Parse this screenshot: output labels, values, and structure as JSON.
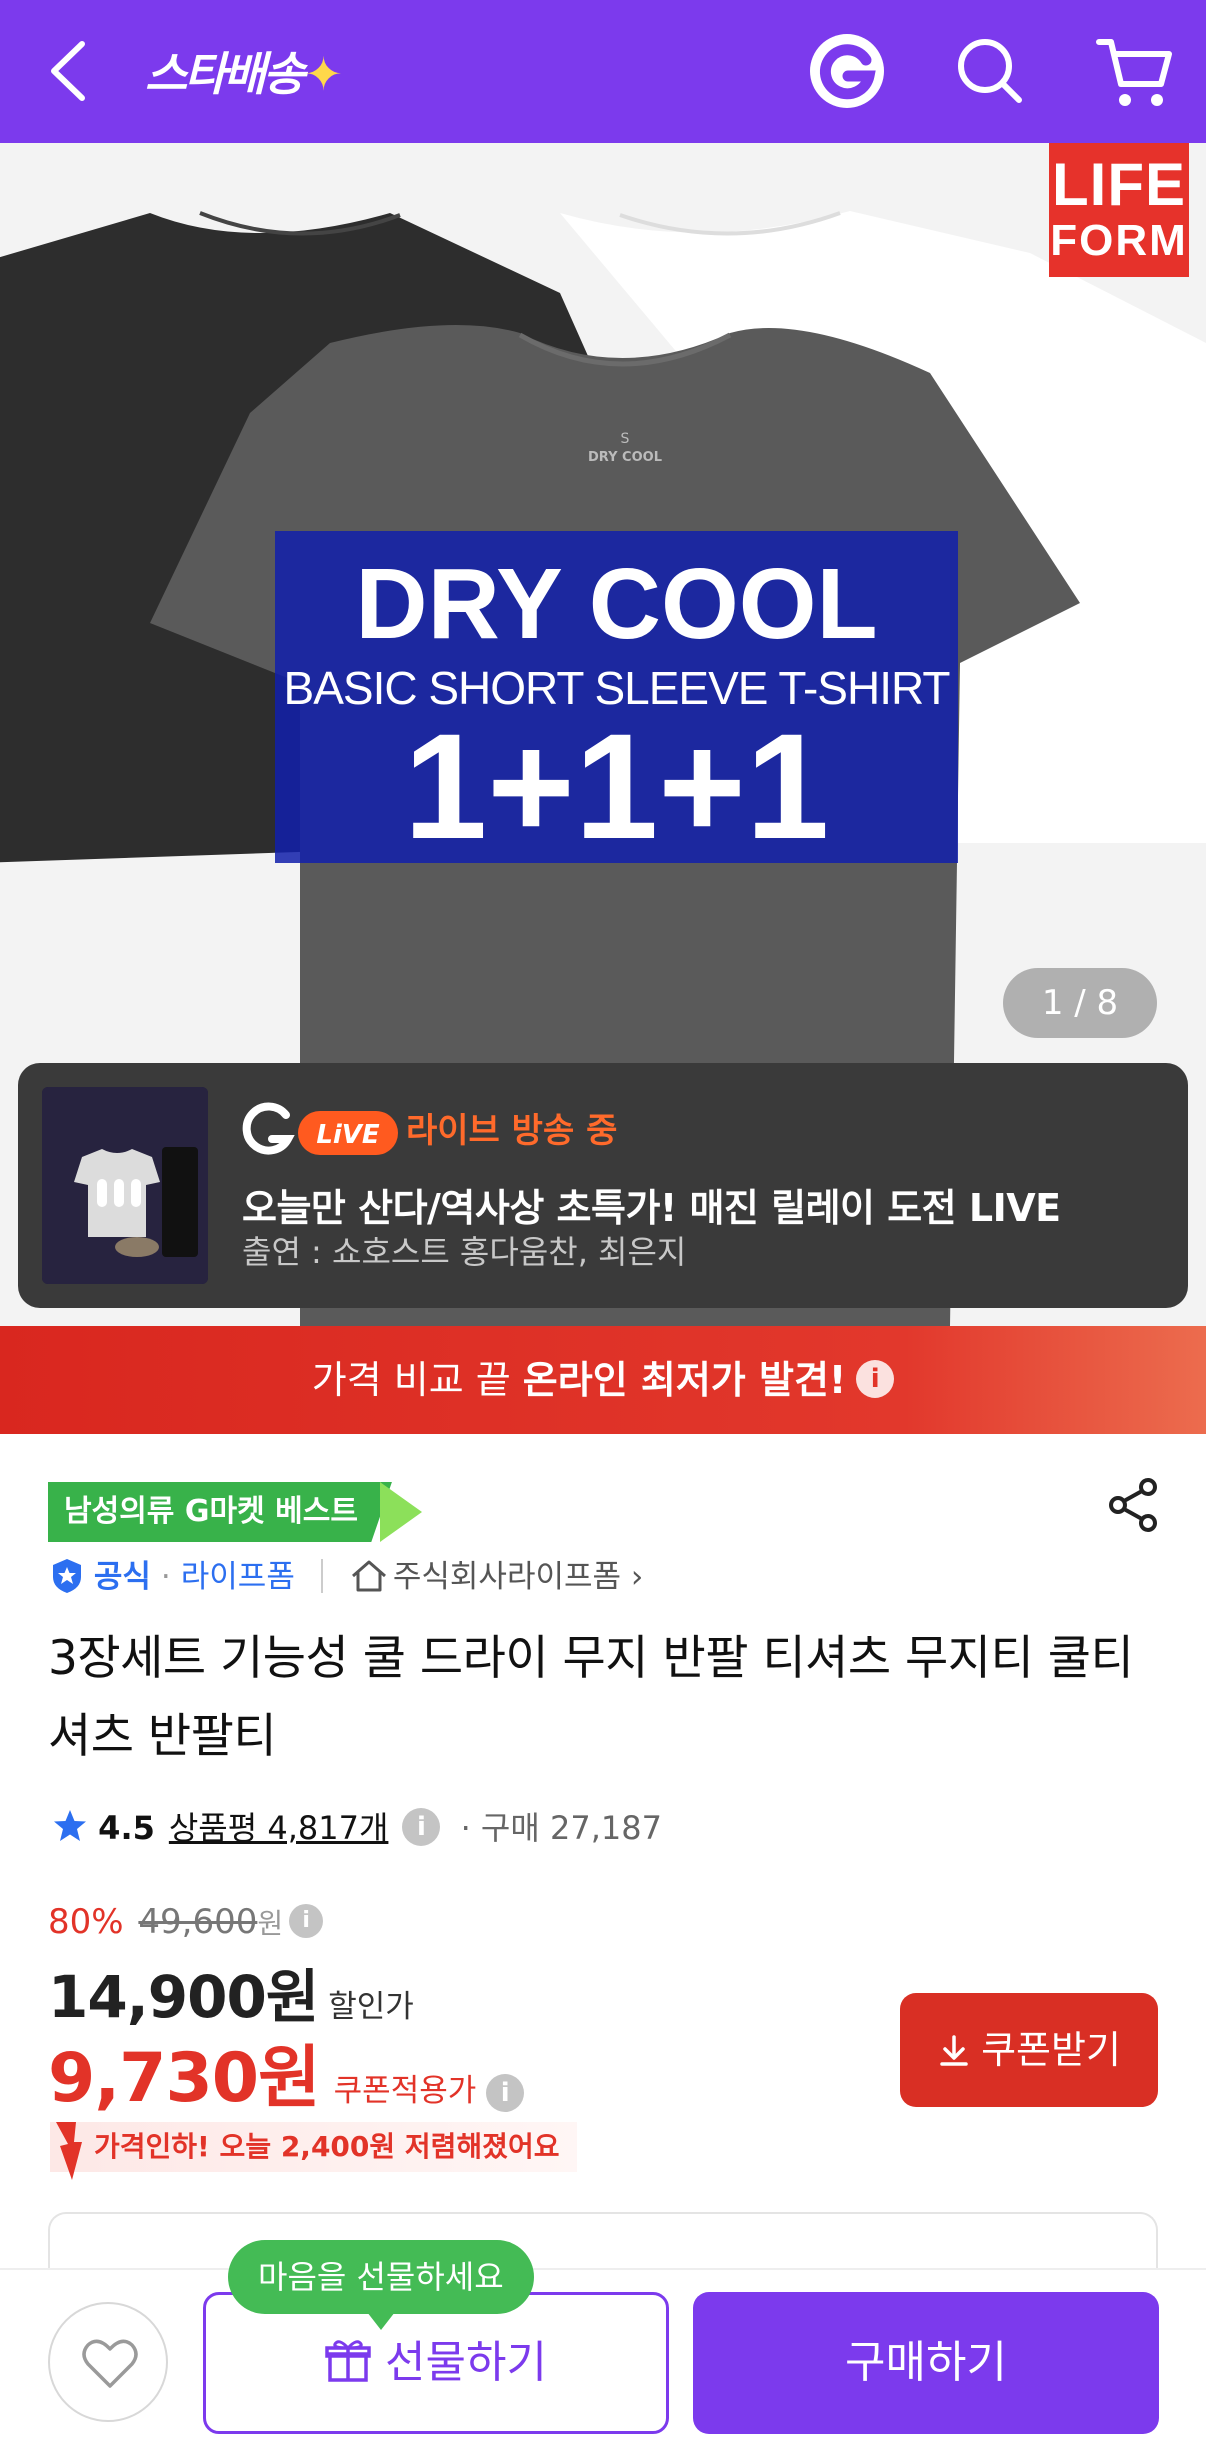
{
  "header": {
    "brand": "스타배송",
    "spark": "✦",
    "icons": [
      "back-arrow-icon",
      "gmarket-g-icon",
      "search-icon",
      "cart-icon"
    ]
  },
  "hero": {
    "badge_line1": "LIFE",
    "badge_line2": "FORM",
    "promo_line1": "DRY COOL",
    "promo_line2": "BASIC SHORT SLEEVE T-SHIRT",
    "promo_line3": "1+1+1",
    "pager": "1 / 8",
    "shirt_tag1": "S",
    "shirt_tag2": "DRY COOL"
  },
  "live": {
    "logo_g": "G",
    "logo_live": "LiVE",
    "status": "라이브 방송 중",
    "title": "오늘만 산다/역사상 초특가! 매진 릴레이 도전 LIVE",
    "cast": "출연 : 쇼호스트 홍다움찬, 최은지"
  },
  "price_banner": {
    "prefix": "가격 비교 끝 ",
    "highlight": "온라인 최저가 발견!",
    "info": "i"
  },
  "product": {
    "best_badge": "남성의류 G마켓 베스트",
    "official": "공식",
    "seller": "라이프폼",
    "store": "주식회사라이프폼",
    "store_chevron": "›",
    "title": "3장세트 기능성 쿨 드라이 무지 반팔 티셔츠 무지티 쿨티셔츠 반팔티",
    "rating": "4.5",
    "review_count": "상품평 4,817개",
    "purchases": "구매 27,187",
    "discount_pct": "80%",
    "original_price": "49,600",
    "original_unit": "원",
    "sale_price": "14,900원",
    "sale_label": "할인가",
    "coupon_price": "9,730원",
    "coupon_label": "쿠폰적용가",
    "coupon_button": "쿠폰받기",
    "price_drop": "가격인하! 오늘 2,400원 저렴해졌어요",
    "info": "i"
  },
  "bottom": {
    "bubble": "마음을 선물하세요",
    "gift": "선물하기",
    "buy": "구매하기"
  },
  "colors": {
    "brand_purple": "#7c3aed",
    "sale_red": "#e23328",
    "best_green": "#38b24a",
    "live_orange": "#ff6a2b"
  }
}
